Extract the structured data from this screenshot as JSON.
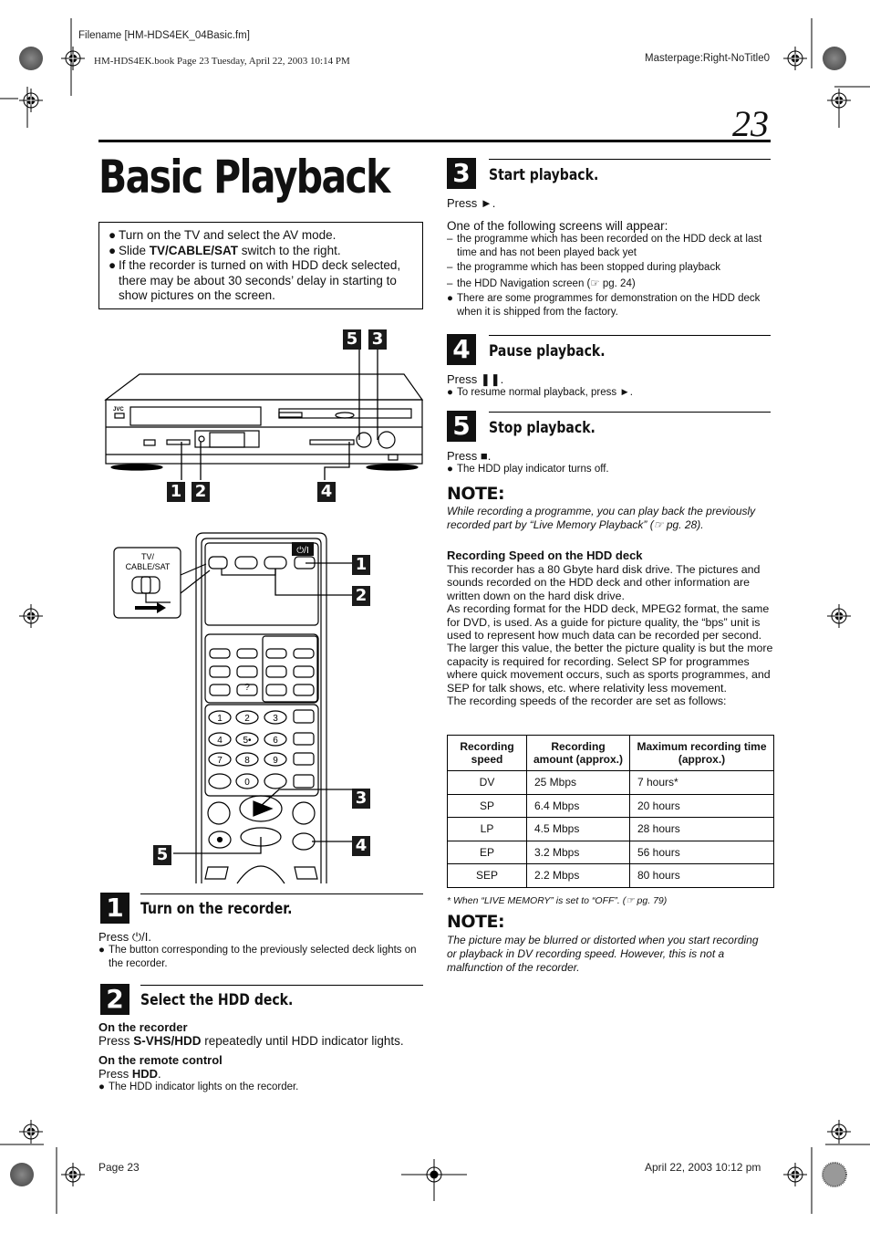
{
  "print_meta": {
    "filename": "Filename [HM-HDS4EK_04Basic.fm]",
    "book_line": "HM-HDS4EK.book  Page 23  Tuesday, April 22, 2003  10:14 PM",
    "masterpage": "Masterpage:Right-NoTitle0",
    "footer_left": "Page 23",
    "footer_right": "April 22, 2003 10:12 pm"
  },
  "page_number": "23",
  "title": "Basic Playback",
  "prep_box": [
    {
      "pre": "Turn on the TV and select the AV mode.",
      "bold": "",
      "post": ""
    },
    {
      "pre": "Slide ",
      "bold": "TV/CABLE/SAT",
      "post": " switch to the right."
    },
    {
      "pre": "If the recorder is turned on with HDD deck selected, there may be about 30 seconds’ delay in starting to show pictures on the screen.",
      "bold": "",
      "post": ""
    }
  ],
  "figure": {
    "recorder_brand": "JVC",
    "recorder_callouts": [
      "5",
      "3",
      "1",
      "2",
      "4"
    ],
    "remote_switch_label": "TV/\nCABLE/SAT",
    "remote_power_label": "⏻/I",
    "remote_callouts": [
      "1",
      "2",
      "3",
      "4",
      "5"
    ],
    "keypad": [
      "1",
      "2",
      "3",
      "4",
      "5•",
      "6",
      "7",
      "8",
      "9",
      "0",
      "?"
    ]
  },
  "steps": [
    {
      "num": "1",
      "heading": "Turn on the recorder.",
      "press": "Press ⏻/I.",
      "bullets": [
        "The button corresponding to the previously selected deck lights on the recorder."
      ]
    },
    {
      "num": "2",
      "heading": "Select the HDD deck.",
      "sub1_title": "On the recorder",
      "sub1_pre": "Press ",
      "sub1_bold": "S-VHS/HDD",
      "sub1_post": " repeatedly until HDD indicator lights.",
      "sub2_title": "On the remote control",
      "sub2_pre": "Press ",
      "sub2_bold": "HDD",
      "sub2_post": ".",
      "bullets": [
        "The HDD indicator lights on the recorder."
      ]
    },
    {
      "num": "3",
      "heading": "Start playback.",
      "press": "Press ►.",
      "intro": "One of the following screens will appear:",
      "dashes": [
        "the programme which has been recorded on the HDD deck at last time and has not been played back yet",
        "the programme which has been stopped during playback",
        "the HDD Navigation screen (☞ pg. 24)"
      ],
      "bullets": [
        "There are some programmes for demonstration on the HDD deck when it is shipped from the factory."
      ]
    },
    {
      "num": "4",
      "heading": "Pause playback.",
      "press": "Press ❚❚.",
      "bullets": [
        "To resume normal playback, press ►."
      ]
    },
    {
      "num": "5",
      "heading": "Stop playback.",
      "press": "Press ■.",
      "bullets": [
        "The HDD play indicator turns off."
      ]
    }
  ],
  "note1": {
    "label": "NOTE:",
    "text": "While recording a programme, you can play back the previously recorded part by “Live Memory Playback” (☞ pg. 28)."
  },
  "recording_speed": {
    "title": "Recording Speed on the HDD deck",
    "paragraphs": [
      "This recorder has a 80 Gbyte hard disk drive. The pictures and sounds recorded on the HDD deck and other information are written down on the hard disk drive.",
      "As recording format for the HDD deck, MPEG2 format, the same for DVD, is used. As a guide for picture quality, the “bps” unit is used to represent how much data can be recorded per second. The larger this value, the better the picture quality is but the more capacity is required for recording. Select SP for programmes where quick movement occurs, such as sports programmes, and SEP for talk shows, etc. where relativity less movement.",
      "The recording speeds of the recorder are set as follows:"
    ],
    "table": {
      "headers": [
        "Recording speed",
        "Recording amount (approx.)",
        "Maximum recording time (approx.)"
      ],
      "rows": [
        [
          "DV",
          "25 Mbps",
          "7 hours*"
        ],
        [
          "SP",
          "6.4 Mbps",
          "20 hours"
        ],
        [
          "LP",
          "4.5 Mbps",
          "28 hours"
        ],
        [
          "EP",
          "3.2 Mbps",
          "56 hours"
        ],
        [
          "SEP",
          "2.2 Mbps",
          "80 hours"
        ]
      ],
      "footnote": "*   When “LIVE MEMORY” is set to “OFF”. (☞ pg. 79)"
    }
  },
  "note2": {
    "label": "NOTE:",
    "text": "The picture may be blurred or distorted when you start recording or playback in DV recording speed. However, this is not a malfunction of the recorder."
  }
}
